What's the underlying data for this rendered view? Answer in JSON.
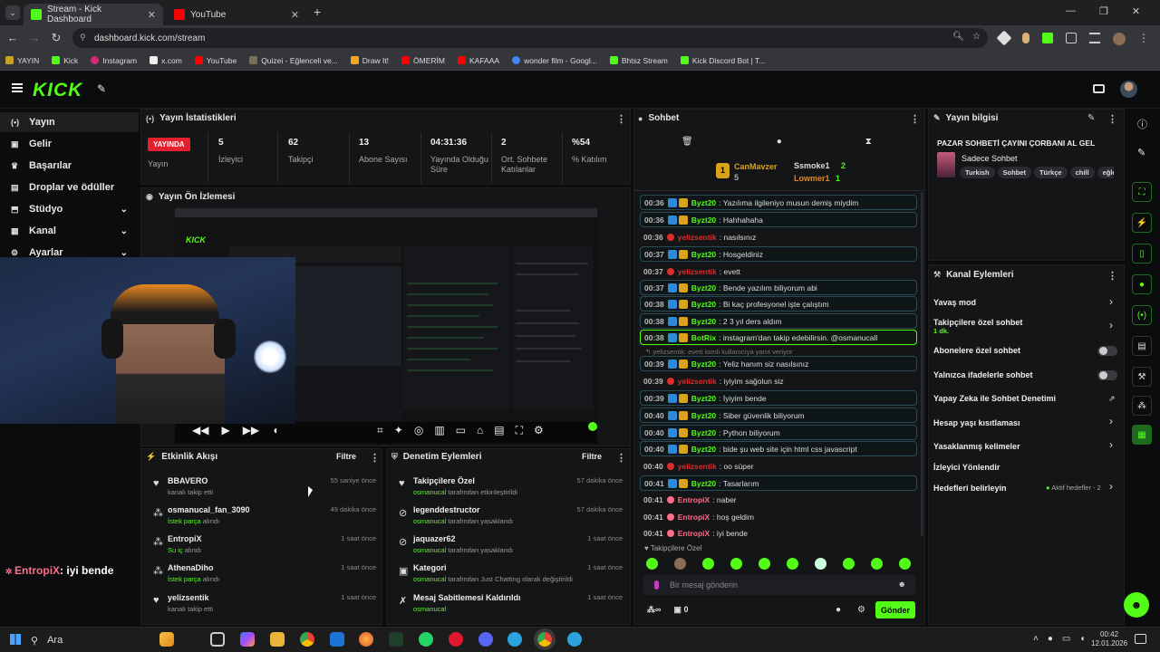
{
  "browser": {
    "tabs": [
      {
        "title": "Stream - Kick Dashboard",
        "color": "#53fc18"
      },
      {
        "title": "YouTube",
        "color": "#ff0000"
      }
    ],
    "url": "dashboard.kick.com/stream",
    "bookmarks": [
      "YAYIN",
      "Kick",
      "Instagram",
      "x.com",
      "YouTube",
      "Quizei - Eğlenceli ve...",
      "Draw It!",
      "ÖMERİM",
      "KAFAAA",
      "wonder film - Googl...",
      "Bhtsz Stream",
      "Kick Discord Bot | T..."
    ]
  },
  "sidebar": {
    "items": [
      {
        "label": "Yayın",
        "icon": "live-icon"
      },
      {
        "label": "Gelir",
        "icon": "revenue-icon"
      },
      {
        "label": "Başarılar",
        "icon": "trophy-icon"
      },
      {
        "label": "Droplar ve ödüller",
        "icon": "gift-icon"
      },
      {
        "label": "Stüdyo",
        "icon": "studio-icon"
      },
      {
        "label": "Kanal",
        "icon": "channel-icon"
      },
      {
        "label": "Ayarlar",
        "icon": "settings-icon"
      }
    ]
  },
  "stats": {
    "title": "Yayın İstatistikleri",
    "live_badge": "YAYINDA",
    "status_label": "Yayın",
    "items": [
      {
        "value": "5",
        "label": "İzleyici"
      },
      {
        "value": "62",
        "label": "Takipçi"
      },
      {
        "value": "13",
        "label": "Abone Sayısı"
      },
      {
        "value": "04:31:36",
        "label": "Yayında Olduğu Süre"
      },
      {
        "value": "2",
        "label": "Ort. Sohbete Katılanlar"
      },
      {
        "value": "%54",
        "label": "% Katılım"
      }
    ]
  },
  "preview": {
    "title": "Yayın Ön İzlemesi"
  },
  "overlay_chat": {
    "user": "EntropiX",
    "text": ": iyi bende"
  },
  "activity": {
    "title": "Etkinlik Akışı",
    "filter": "Filtre",
    "rows": [
      {
        "name": "BBAVERO",
        "sub": "kanalı takip etti",
        "subgreen": "",
        "time": "55 saniye önce"
      },
      {
        "name": "osmanucal_fan_3090",
        "sub": "alındı",
        "subgreen": "İstek parça",
        "time": "49 dakika önce"
      },
      {
        "name": "EntropiX",
        "sub": "alındı",
        "subgreen": "Su iç",
        "time": "1 saat önce"
      },
      {
        "name": "AthenaDiho",
        "sub": "alındı",
        "subgreen": "İstek parça",
        "time": "1 saat önce"
      },
      {
        "name": "yelizsentik",
        "sub": "kanalı takip etti",
        "subgreen": "",
        "time": "1 saat önce"
      }
    ]
  },
  "moderation": {
    "title": "Denetim Eylemleri",
    "filter": "Filtre",
    "rows": [
      {
        "name": "Takipçilere Özel",
        "green": "osmanucal",
        "sub": "tarafından etkinleştirildi",
        "time": "57 dakika önce"
      },
      {
        "name": "legenddestructor",
        "green": "osmanucal",
        "sub": "tarafından yasaklandı",
        "time": "57 dakika önce"
      },
      {
        "name": "jaquazer62",
        "green": "osmanucal",
        "sub": "tarafından yasaklandı",
        "time": "1 saat önce"
      },
      {
        "name": "Kategori",
        "green": "osmanucal",
        "sub": "tarafından Just Chatting olarak değiştirildi",
        "time": "1 saat önce"
      },
      {
        "name": "Mesaj Sabitlemesi Kaldırıldı",
        "green": "osmanucal",
        "sub": "tarafından yasaklandı",
        "time": "1 saat önce"
      }
    ]
  },
  "chat": {
    "title": "Sohbet",
    "top_users": [
      {
        "name": "CanMavzer",
        "count": "5"
      },
      {
        "name": "Ssmoke1",
        "count": "2"
      },
      {
        "name": "Lowmer1",
        "count": "1"
      }
    ],
    "messages": [
      {
        "time": "00:36",
        "user": "Byzt20",
        "text": ": Yazılıma ilgileniyo musun demiş miydim",
        "color": "#53fc18",
        "style": "box",
        "badges": true
      },
      {
        "time": "00:36",
        "user": "Byzt20",
        "text": ": Hahhahaha",
        "color": "#53fc18",
        "style": "box",
        "badges": true
      },
      {
        "time": "00:36",
        "user": "yelizsentik",
        "text": ": nasılsınız",
        "color": "#e02b2b",
        "style": "",
        "badges": false
      },
      {
        "time": "00:37",
        "user": "Byzt20",
        "text": ": Hosgeldiniz",
        "color": "#53fc18",
        "style": "box",
        "badges": true
      },
      {
        "time": "00:37",
        "user": "yelizsentik",
        "text": ": evett",
        "color": "#e02b2b",
        "style": "",
        "badges": false
      },
      {
        "time": "00:37",
        "user": "Byzt20",
        "text": ": Bende yazılım biliyorum abi",
        "color": "#53fc18",
        "style": "box",
        "badges": true
      },
      {
        "time": "00:38",
        "user": "Byzt20",
        "text": ": Bi kaç profesyonel işte çalıştım",
        "color": "#53fc18",
        "style": "box",
        "badges": true
      },
      {
        "time": "00:38",
        "user": "Byzt20",
        "text": ": 2 3 yıl ders aldım",
        "color": "#53fc18",
        "style": "box",
        "badges": true
      },
      {
        "time": "00:38",
        "user": "BotRix",
        "text": ": instagram'dan takip edebilirsin. @osmanucall",
        "color": "#53fc18",
        "style": "hl",
        "badges": true
      },
      {
        "time": "00:39",
        "user": "Byzt20",
        "text": ": Yeliz hanım siz nasılsınız",
        "color": "#53fc18",
        "style": "box",
        "badges": true
      },
      {
        "time": "00:39",
        "user": "yelizsentik",
        "text": ": iyiyim sağolun siz",
        "color": "#e02b2b",
        "style": "",
        "badges": false
      },
      {
        "time": "00:39",
        "user": "Byzt20",
        "text": ": İyiyim bende",
        "color": "#53fc18",
        "style": "box",
        "badges": true
      },
      {
        "time": "00:40",
        "user": "Byzt20",
        "text": ": Siber güvenlik biliyorum",
        "color": "#53fc18",
        "style": "box",
        "badges": true
      },
      {
        "time": "00:40",
        "user": "Byzt20",
        "text": ": Python biliyorum",
        "color": "#53fc18",
        "style": "box",
        "badges": true
      },
      {
        "time": "00:40",
        "user": "Byzt20",
        "text": ": bide şu web site için html css javascript",
        "color": "#53fc18",
        "style": "box",
        "badges": true
      },
      {
        "time": "00:40",
        "user": "yelizsentik",
        "text": ": oo süper",
        "color": "#e02b2b",
        "style": "",
        "badges": false
      },
      {
        "time": "00:41",
        "user": "Byzt20",
        "text": ": Tasarlarım",
        "color": "#53fc18",
        "style": "box",
        "badges": true
      },
      {
        "time": "00:41",
        "user": "EntropiX",
        "text": ": naber",
        "color": "#ff6b8a",
        "style": "",
        "badges": false
      },
      {
        "time": "00:41",
        "user": "EntropiX",
        "text": ": hoş geldim",
        "color": "#ff6b8a",
        "style": "",
        "badges": false
      },
      {
        "time": "00:41",
        "user": "EntropiX",
        "text": ": iyi bende",
        "color": "#ff6b8a",
        "style": "",
        "badges": false
      }
    ],
    "reply_hint": "yelizsentik: evett isimli kullanıcıya yanıt veriyor",
    "mode_label": "Takipçilere Özel",
    "placeholder": "Bir mesaj gönderin",
    "count": "0",
    "send": "Gönder"
  },
  "stream_info": {
    "title": "Yayın bilgisi",
    "stream_title": "PAZAR SOHBETİ ÇAYINI ÇORBANI AL GEL",
    "category": "Sadece Sohbet",
    "tags": [
      "Turkish",
      "Sohbet",
      "Türkçe",
      "chill",
      "eğlen"
    ]
  },
  "channel_actions": {
    "title": "Kanal Eylemleri",
    "items": [
      {
        "label": "Yavaş mod",
        "control": "chevron"
      },
      {
        "label": "Takipçilere özel sohbet",
        "control": "chevron",
        "note": "1 dk."
      },
      {
        "label": "Abonelere özel sohbet",
        "control": "toggle"
      },
      {
        "label": "Yalnızca ifadelerle sohbet",
        "control": "toggle"
      },
      {
        "label": "Yapay Zeka ile Sohbet Denetimi",
        "control": "external"
      },
      {
        "label": "Hesap yaşı kısıtlaması",
        "control": "chevron"
      },
      {
        "label": "Yasaklanmış kelimeler",
        "control": "chevron"
      },
      {
        "label": "İzleyici Yönlendir",
        "control": "none"
      },
      {
        "label": "Hedefleri belirleyin",
        "control": "chevron",
        "note": "Aktif hedefler - 2"
      }
    ]
  },
  "taskbar": {
    "search": "Ara",
    "time": "00:42",
    "date": "12.01.2026"
  }
}
